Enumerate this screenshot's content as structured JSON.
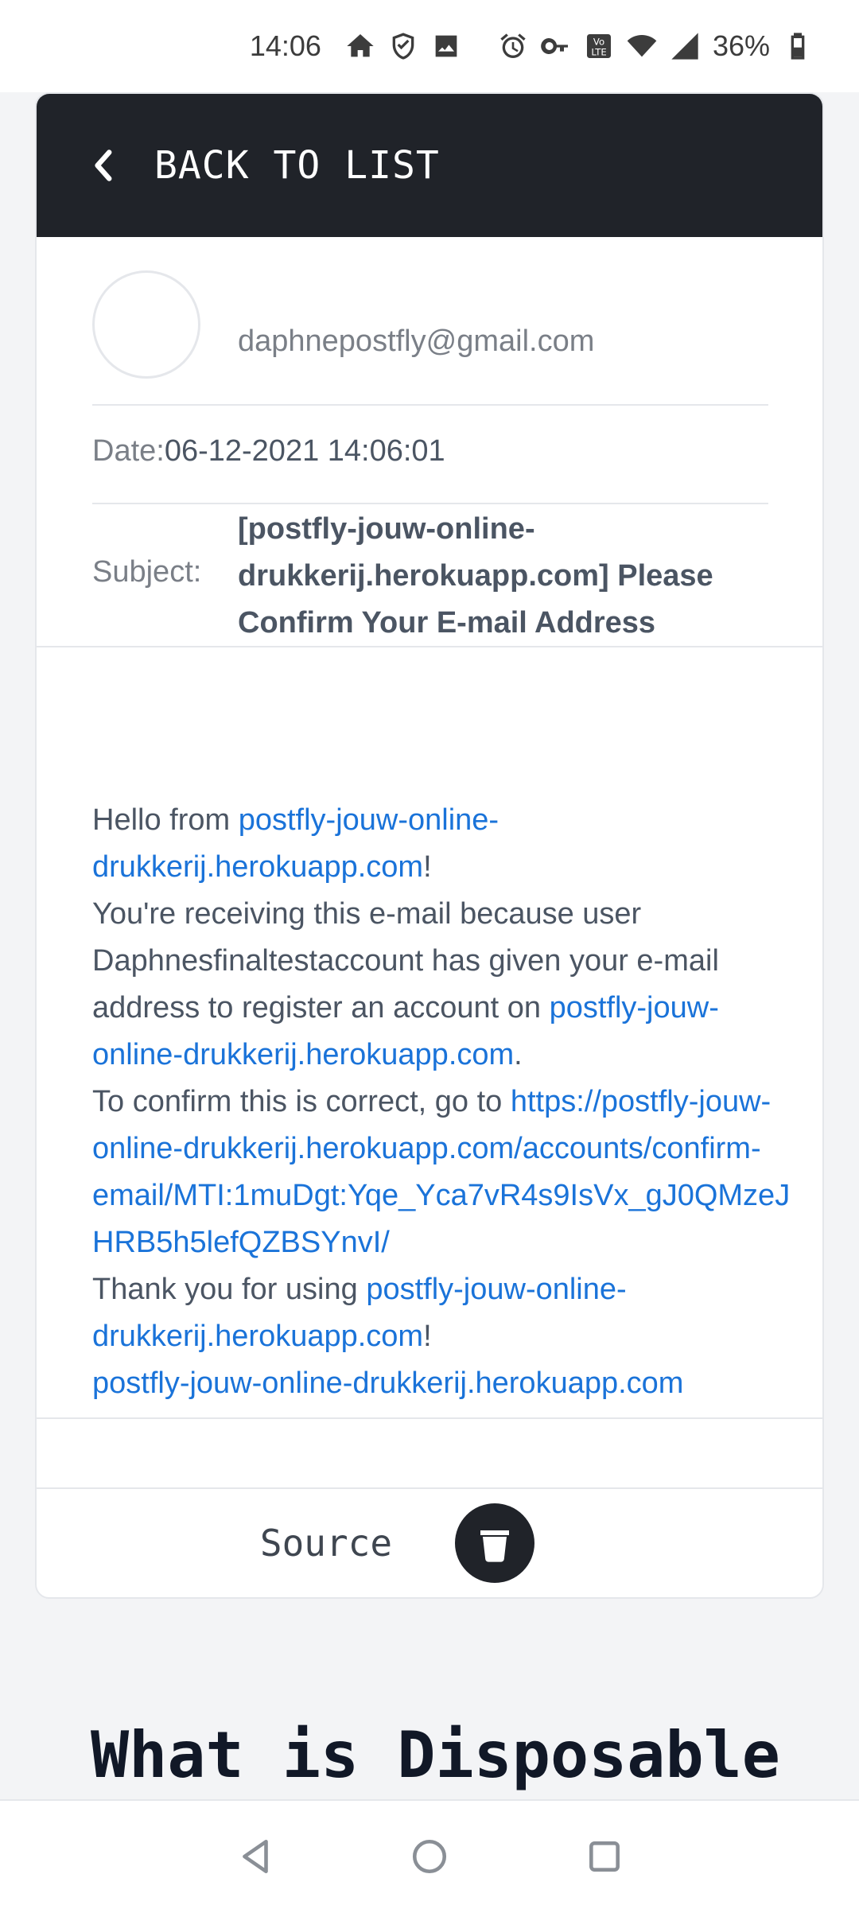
{
  "status_bar": {
    "time": "14:06",
    "battery_percent": "36%",
    "icons": [
      "home-icon",
      "shield-icon",
      "image-icon",
      "alarm-icon",
      "key-icon",
      "volte-icon",
      "wifi-icon",
      "signal-icon",
      "battery-icon"
    ]
  },
  "header": {
    "back_label": "BACK TO LIST"
  },
  "email": {
    "sender": "daphnepostfly@gmail.com",
    "date_label": "Date:",
    "date_value": "06-12-2021 14:06:01",
    "subject_label": "Subject:",
    "subject_value": "[postfly-jouw-online-drukkerij.herokuapp.com] Please Confirm Your E-mail Address",
    "body": {
      "greeting": "Hello from ",
      "site_link": "postfly-jouw-online-drukkerij.herokuapp.com",
      "exclaim": "!",
      "receiving": "You're receiving this e-mail because user Daphnesfinaltestaccount has given your e-mail address to register an account on ",
      "period": ".",
      "confirm_text": "To confirm this is correct, go to ",
      "confirm_link": "https://postfly-jouw-online-drukkerij.herokuapp.com/accounts/confirm-email/MTI:1muDgt:Yqe_Yca7vR4s9IsVx_gJ0QMzeJHRB5h5lefQZBSYnvI/",
      "thanks": "Thank you for using "
    }
  },
  "actions": {
    "source_label": "Source"
  },
  "section": {
    "heading": "What is Disposable"
  },
  "colors": {
    "header_bg": "#202329",
    "link": "#1a73d9",
    "page_bg": "#f3f4f6"
  }
}
